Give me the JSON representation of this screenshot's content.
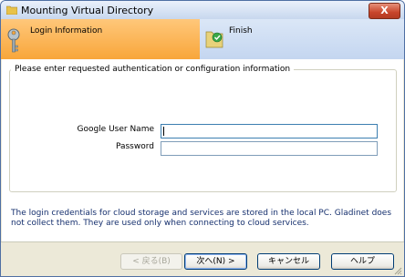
{
  "window": {
    "title": "Mounting Virtual Directory",
    "close_label": "X"
  },
  "steps": [
    {
      "label": "Login Information",
      "active": true
    },
    {
      "label": "Finish",
      "active": false
    }
  ],
  "group": {
    "legend": "Please enter requested authentication or configuration information"
  },
  "fields": {
    "user_label": "Google User Name",
    "user_value": "",
    "password_label": "Password",
    "password_value": ""
  },
  "note": "The login credentials for cloud storage and services are stored in the local PC. Gladinet does not collect them. They are used only when connecting to cloud services.",
  "buttons": {
    "back": "< 戻る(B)",
    "next": "次へ(N) >",
    "cancel": "キャンセル",
    "help": "ヘルプ"
  },
  "colors": {
    "active_step": "#f8a63a",
    "header_bg": "#c4d6f0",
    "note_text": "#16306e"
  }
}
